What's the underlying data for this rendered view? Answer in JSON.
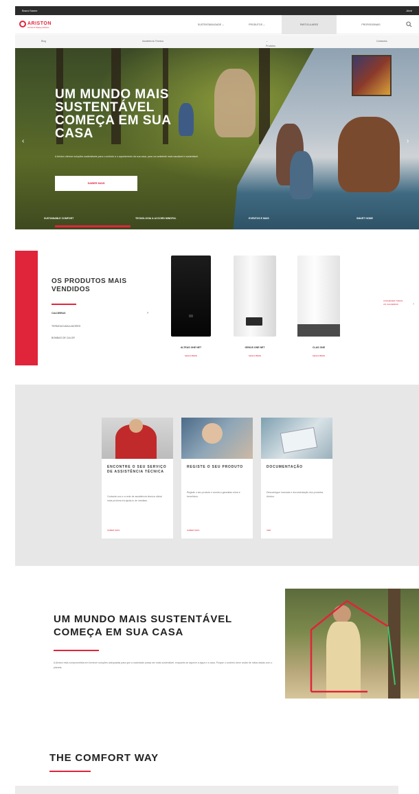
{
  "colors": {
    "accent": "#e0243a",
    "topbar": "#2b2b2b",
    "services_bg": "#e7e7e7"
  },
  "topbar": {
    "left": "Brand Name",
    "right": "Abrir"
  },
  "nav": {
    "brand": "ARISTON",
    "tagline": "Comfort & Heating Solutions",
    "items": [
      {
        "label": "SUSTENTABILIDADE"
      },
      {
        "label": "PRODUTOS"
      },
      {
        "label": "PARTICULARES"
      },
      {
        "label": "PROFISSIONAIS"
      }
    ]
  },
  "subnav": {
    "items": [
      "Blog",
      "Assistência Técnica",
      "Produtos",
      "Contactos"
    ]
  },
  "hero": {
    "title": "UM MUNDO MAIS SUSTENTÁVEL COMEÇA EM SUA CASA",
    "description": "A Ariston oferece soluções sustentáveis para o conforto e o aquecimento da sua casa, para um ambiente mais saudável e sustentável.",
    "cta": "SABER MAIS",
    "tabs": [
      "SUSTAINABLE COMFORT",
      "TECNOLOGIA & ACCORD MINDFUL",
      "EVENTOS E MAIS",
      "SMART HOME"
    ]
  },
  "bestsellers": {
    "title": "OS PRODUTOS MAIS VENDIDOS",
    "categories": [
      "CALDEIRAS",
      "TERMOACUMULADORES",
      "BOMBAS DE CALOR"
    ],
    "products": [
      {
        "name": "ALTEAS ONE NET",
        "link": "DESCOBRIR"
      },
      {
        "name": "GENUS ONE NET",
        "link": "DESCOBRIR"
      },
      {
        "name": "CLAS ONE",
        "link": "DESCOBRIR"
      }
    ],
    "next_label": "CONHECER TODAS AS CALDEIRAS"
  },
  "services": {
    "cards": [
      {
        "title": "ENCONTRE O SEU SERVIÇO DE ASSISTÊNCIA TÉCNICA",
        "desc": "Contacte-nos e a rede de assistência técnica oficial mais próxima irá ajudá-lo de imediato.",
        "link": "SABER MAIS"
      },
      {
        "title": "REGISTE O SEU PRODUTO",
        "desc": "Registe o seu produto e aceda a garantias extra e benefícios.",
        "link": "SABER MAIS"
      },
      {
        "title": "DOCUMENTAÇÃO",
        "desc": "Descarregue manuais e documentação dos produtos Ariston.",
        "link": "VER"
      }
    ]
  },
  "sustainability": {
    "title": "UM MUNDO MAIS SUSTENTÁVEL COMEÇA EM SUA CASA",
    "desc": "A Ariston está comprometida em fornecer soluções adequadas para que a sociedade possa ser mais sustentável, enquanto se aquece a água e a casa. Porque o conforto deve andar de mãos dadas com o planeta."
  },
  "comfort": {
    "title": "THE COMFORT WAY"
  }
}
